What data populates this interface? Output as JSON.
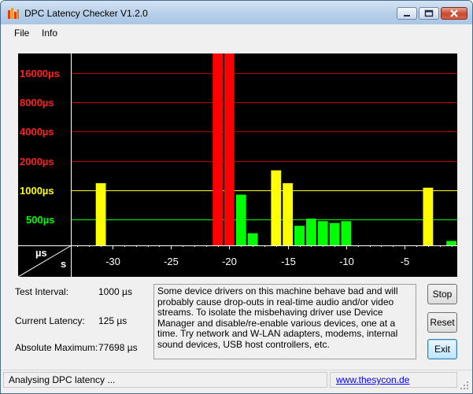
{
  "window": {
    "title": "DPC Latency Checker V1.2.0"
  },
  "menu": {
    "items": [
      "File",
      "Info"
    ]
  },
  "colors": {
    "grid": "#c00000",
    "ok": "#00ff00",
    "warn": "#ffff00",
    "bad": "#ff0000",
    "label_bad": "#ff2020",
    "label_warn": "#ffff00",
    "label_ok": "#00ff00"
  },
  "chart_data": {
    "type": "bar",
    "y_tick_labels": [
      "16000µs",
      "8000µs",
      "4000µs",
      "2000µs",
      "1000µs",
      "500µs"
    ],
    "y_unit": "µs",
    "x_unit": "s",
    "x_ticks": [
      -30,
      -25,
      -20,
      -15,
      -10,
      -5
    ],
    "x_tick_labels": [
      "-30",
      "-25",
      "-20",
      "-15",
      "-10",
      "-5"
    ],
    "x_range": [
      -33.5,
      -0.5
    ],
    "bars": [
      {
        "t": -33,
        "level": "ok",
        "value": 190
      },
      {
        "t": -32,
        "level": "ok",
        "value": 220
      },
      {
        "t": -31,
        "level": "warn",
        "value": 1180
      },
      {
        "t": -30,
        "level": "ok",
        "value": 190
      },
      {
        "t": -29,
        "level": "ok",
        "value": 180
      },
      {
        "t": -28,
        "level": "ok",
        "value": 120
      },
      {
        "t": -27,
        "level": "ok",
        "value": 115
      },
      {
        "t": -26,
        "level": "ok",
        "value": 120
      },
      {
        "t": -25,
        "level": "ok",
        "value": 120
      },
      {
        "t": -24,
        "level": "ok",
        "value": 120
      },
      {
        "t": -23,
        "level": "ok",
        "value": 125
      },
      {
        "t": -22,
        "level": "ok",
        "value": 200
      },
      {
        "t": -21,
        "level": "bad",
        "value": 77698
      },
      {
        "t": -20,
        "level": "bad",
        "value": 70000
      },
      {
        "t": -19,
        "level": "ok",
        "value": 900
      },
      {
        "t": -18,
        "level": "ok",
        "value": 360
      },
      {
        "t": -17,
        "level": "ok",
        "value": 230
      },
      {
        "t": -16,
        "level": "warn",
        "value": 1600
      },
      {
        "t": -15,
        "level": "warn",
        "value": 1180
      },
      {
        "t": -14,
        "level": "ok",
        "value": 430
      },
      {
        "t": -13,
        "level": "ok",
        "value": 510
      },
      {
        "t": -12,
        "level": "ok",
        "value": 480
      },
      {
        "t": -11,
        "level": "ok",
        "value": 460
      },
      {
        "t": -10,
        "level": "ok",
        "value": 480
      },
      {
        "t": -9,
        "level": "ok",
        "value": 230
      },
      {
        "t": -8,
        "level": "ok",
        "value": 250
      },
      {
        "t": -7,
        "level": "ok",
        "value": 260
      },
      {
        "t": -6,
        "level": "ok",
        "value": 230
      },
      {
        "t": -5,
        "level": "ok",
        "value": 220
      },
      {
        "t": -4,
        "level": "ok",
        "value": 200
      },
      {
        "t": -3,
        "level": "warn",
        "value": 1060
      },
      {
        "t": -2,
        "level": "ok",
        "value": 210
      },
      {
        "t": -1,
        "level": "ok",
        "value": 300
      }
    ],
    "y_grid": true
  },
  "info": {
    "test_interval_label": "Test Interval:",
    "test_interval_value": "1000 µs",
    "current_latency_label": "Current Latency:",
    "current_latency_value": "125 µs",
    "absolute_max_label": "Absolute Maximum:",
    "absolute_max_value": "77698 µs"
  },
  "message": "Some device drivers on this machine behave bad and will probably cause drop-outs in real-time audio and/or video streams. To isolate the misbehaving driver use Device Manager and disable/re-enable various devices, one at a time. Try network and W-LAN adapters, modems, internal sound devices, USB host controllers, etc.",
  "buttons": {
    "stop": "Stop",
    "reset": "Reset",
    "exit": "Exit"
  },
  "status": {
    "text": "Analysing DPC latency ...",
    "link": "www.thesycon.de"
  }
}
